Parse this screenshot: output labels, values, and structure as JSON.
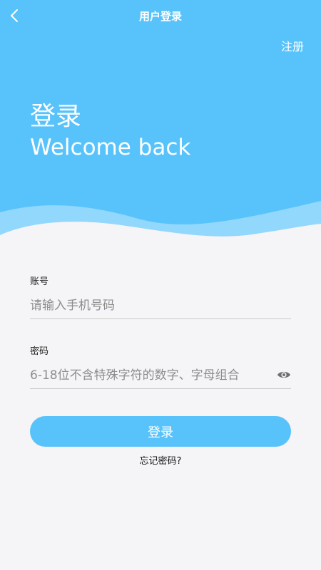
{
  "nav": {
    "title": "用户登录",
    "register_label": "注册"
  },
  "hero": {
    "title": "登录",
    "subtitle": "Welcome back"
  },
  "form": {
    "account": {
      "label": "账号",
      "placeholder": "请输入手机号码"
    },
    "password": {
      "label": "密码",
      "placeholder": "6-18位不含特殊字符的数字、字母组合"
    },
    "submit_label": "登录",
    "forgot_label": "忘记密码?"
  },
  "colors": {
    "accent": "#58c3fb",
    "background": "#f5f4f6"
  },
  "icons": {
    "back": "chevron-left-icon",
    "show_password": "eye-icon"
  }
}
